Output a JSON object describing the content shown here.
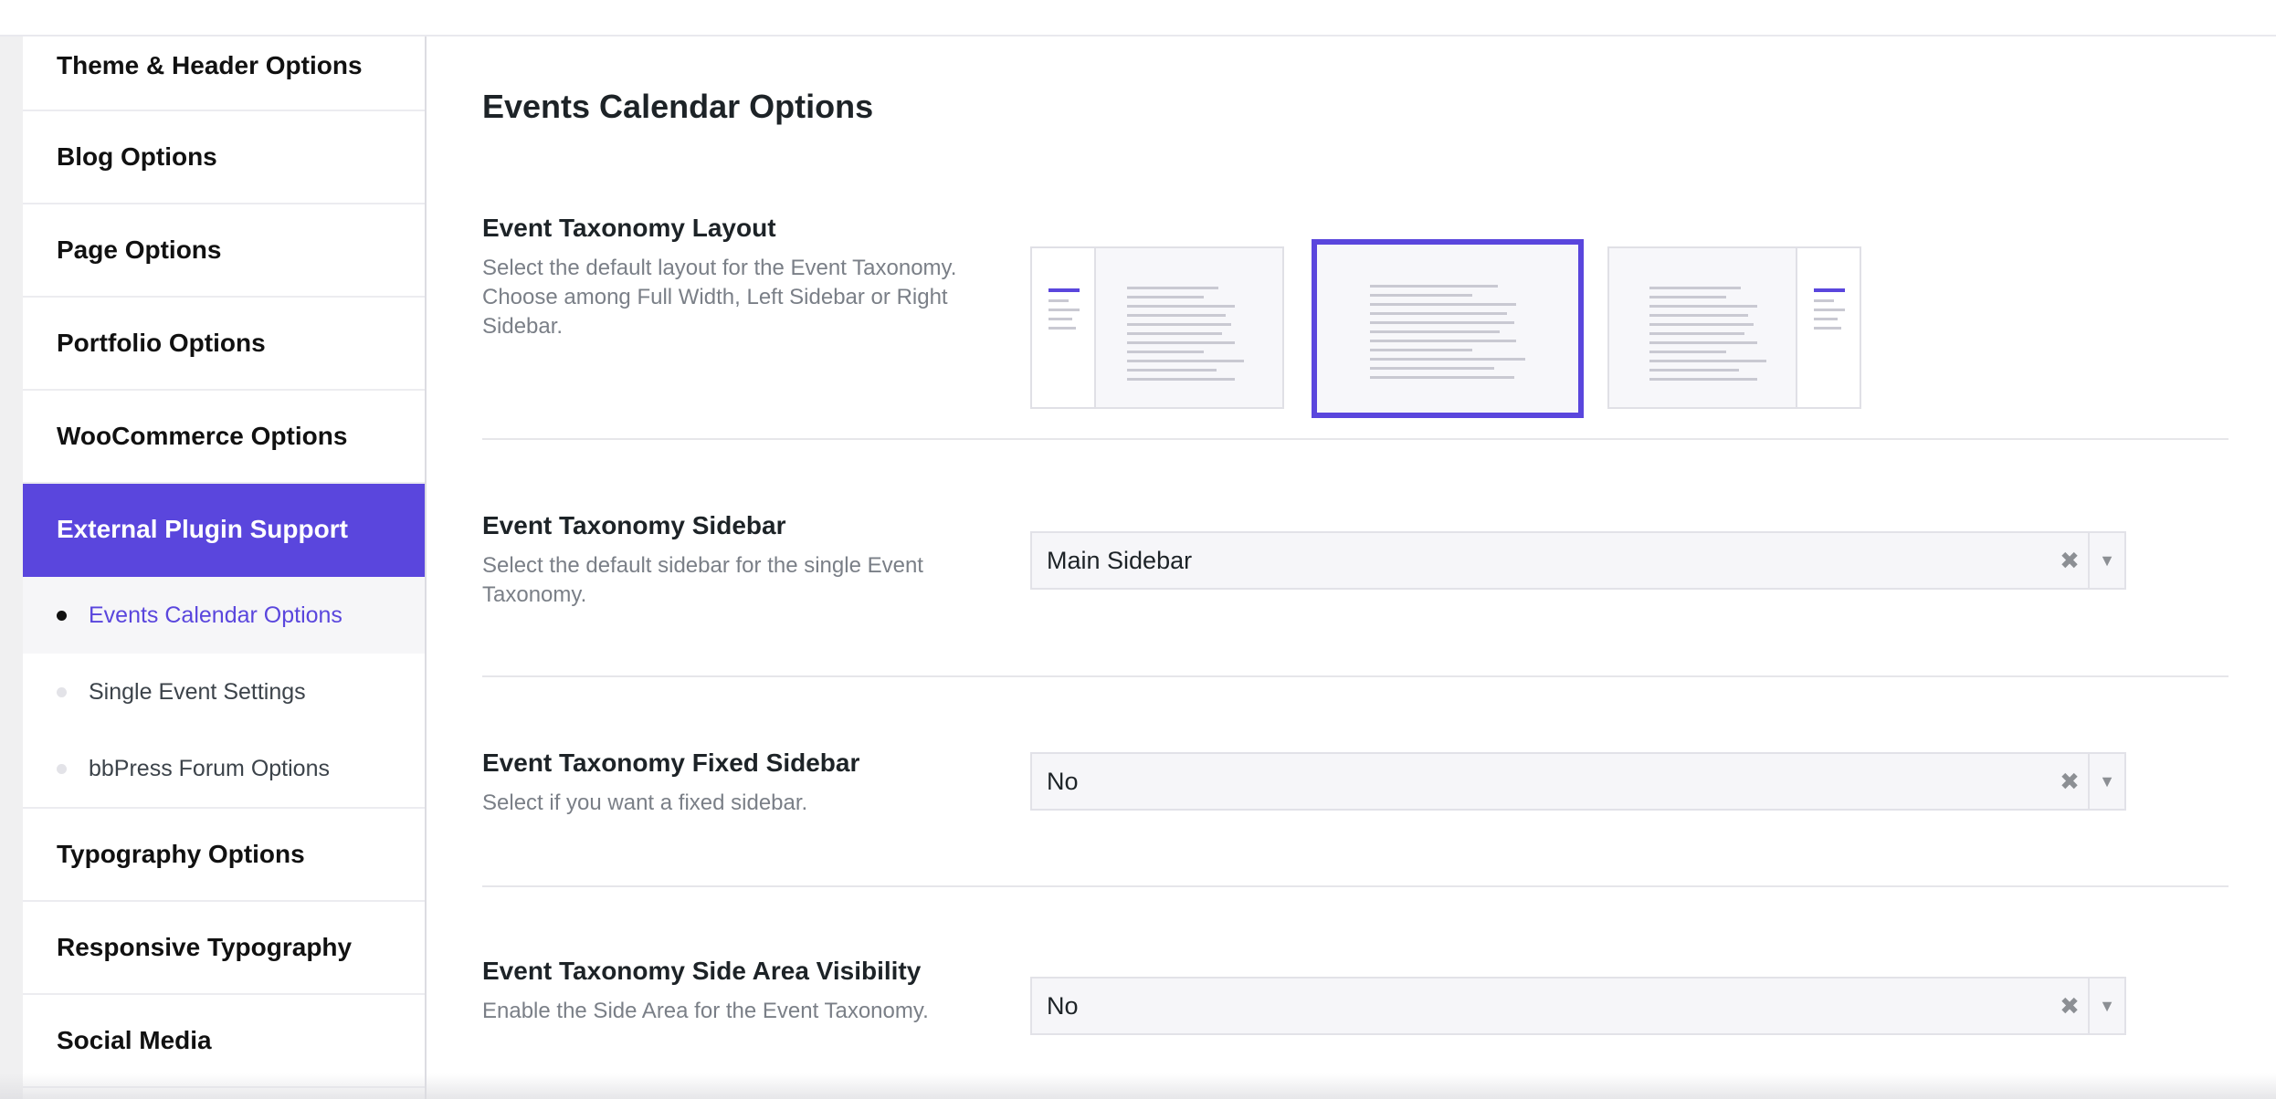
{
  "sidebar": {
    "items": [
      {
        "label": "Theme & Header Options"
      },
      {
        "label": "Blog Options"
      },
      {
        "label": "Page Options"
      },
      {
        "label": "Portfolio Options"
      },
      {
        "label": "WooCommerce Options"
      },
      {
        "label": "External Plugin Support",
        "active": true
      }
    ],
    "subitems": [
      {
        "label": "Events Calendar Options",
        "active": true
      },
      {
        "label": "Single Event Settings"
      },
      {
        "label": "bbPress Forum Options"
      }
    ],
    "items_after": [
      {
        "label": "Typography Options"
      },
      {
        "label": "Responsive Typography"
      },
      {
        "label": "Social Media"
      }
    ]
  },
  "main": {
    "title": "Events Calendar Options",
    "fields": {
      "layout": {
        "title": "Event Taxonomy Layout",
        "description": "Select the default layout for the Event Taxonomy. Choose among Full Width, Left Sidebar or Right Sidebar.",
        "options": [
          "left-sidebar",
          "full-width",
          "right-sidebar"
        ],
        "selected": "full-width"
      },
      "sidebar": {
        "title": "Event Taxonomy Sidebar",
        "description": "Select the default sidebar for the single Event Taxonomy.",
        "value": "Main Sidebar"
      },
      "fixed_sidebar": {
        "title": "Event Taxonomy Fixed Sidebar",
        "description": "Select if you want a fixed sidebar.",
        "value": "No"
      },
      "side_area": {
        "title": "Event Taxonomy Side Area Visibility",
        "description": "Enable the Side Area for the Event Taxonomy.",
        "value": "No"
      }
    }
  },
  "icons": {
    "clear": "✖",
    "dropdown": "▼"
  },
  "colors": {
    "accent": "#5a46dd"
  }
}
